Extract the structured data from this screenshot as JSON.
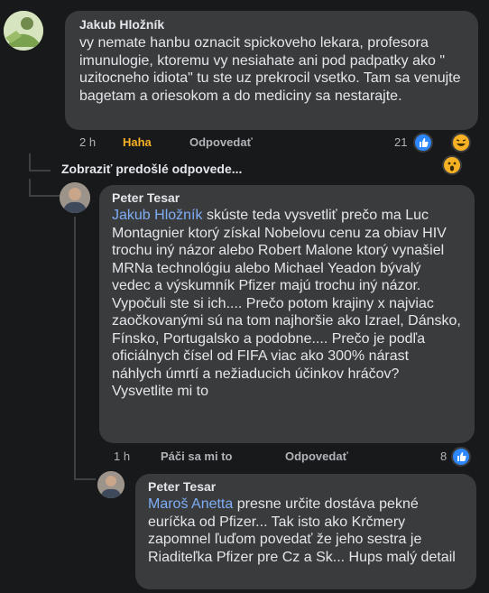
{
  "comments": [
    {
      "author": "Jakub Hložník",
      "text": "vy nemate hanbu oznacit spickoveho lekara, profesora imunulogie, ktoremu vy nesiahate ani pod padpatky ako \" uzitocneho idiota\"  tu ste uz prekrocil vsetko. Tam sa venujte bagetam a oriesokom a do mediciny sa nestarajte.",
      "time": "2 h",
      "reaction_label": "Haha",
      "reply_label": "Odpovedať",
      "reaction_count": "21",
      "reactions": [
        "like",
        "haha",
        "wow"
      ]
    },
    {
      "author": "Peter Tesar",
      "mention": "Jakub Hložník",
      "text": " skúste teda vysvetliť prečo ma Luc Montagnier ktorý získal Nobelovu cenu za obiav HIV trochu iný názor alebo Robert Malone ktorý vynašiel MRNa technológiu alebo Michael Yeadon bývalý vedec a výskumník Pfizer majú trochu iný názor. Vypočuli ste si ich.... Prečo potom krajiny x najviac zaočkovanými sú na tom najhoršie ako Izrael, Dánsko, Fínsko, Portugalsko a podobne.... Prečo je podľa oficiálnych čísel od FIFA viac ako 300% nárast náhlych úmrtí a nežiaducich účinkov hráčov? Vysvetlite mi to",
      "time": "1 h",
      "like_label": "Páči sa mi to",
      "reply_label": "Odpovedať",
      "reaction_count": "8",
      "reactions": [
        "like"
      ]
    },
    {
      "author": "Peter Tesar",
      "mention": "Maroš Anetta",
      "text": " presne určite dostáva pekné euríčka od Pfizer... Tak isto ako Krčmery zapomnel ľuďom povedať že jeho sestra je Riaditeľka Pfizer pre Cz a Sk... Hups malý detail"
    }
  ],
  "show_previous_label": "Zobraziť predošlé odpovede...",
  "colors": {
    "background": "#18191a",
    "bubble": "#3a3b3c",
    "mention": "#7eaef7",
    "haha": "#f7b125",
    "like": "#2d88ff"
  }
}
